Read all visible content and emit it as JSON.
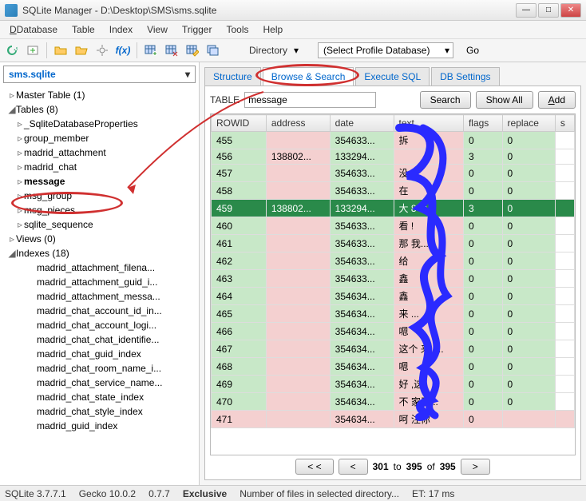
{
  "window": {
    "title": "SQLite Manager - D:\\Desktop\\SMS\\sms.sqlite"
  },
  "menu": [
    "Database",
    "Table",
    "Index",
    "View",
    "Trigger",
    "Tools",
    "Help"
  ],
  "toolbar": {
    "directory_label": "Directory",
    "profile_select": "(Select Profile Database)",
    "go": "Go"
  },
  "sidebar": {
    "db": "sms.sqlite",
    "nodes": [
      {
        "lvl": 0,
        "tw": "▹",
        "label": "Master Table (1)"
      },
      {
        "lvl": 0,
        "tw": "◢",
        "label": "Tables (8)"
      },
      {
        "lvl": 1,
        "tw": "▹",
        "label": "_SqliteDatabaseProperties"
      },
      {
        "lvl": 1,
        "tw": "▹",
        "label": "group_member"
      },
      {
        "lvl": 1,
        "tw": "▹",
        "label": "madrid_attachment"
      },
      {
        "lvl": 1,
        "tw": "▹",
        "label": "madrid_chat"
      },
      {
        "lvl": 1,
        "tw": "▹",
        "label": "message",
        "hl": true
      },
      {
        "lvl": 1,
        "tw": "▹",
        "label": "msg_group"
      },
      {
        "lvl": 1,
        "tw": "▹",
        "label": "msg_pieces"
      },
      {
        "lvl": 1,
        "tw": "▹",
        "label": "sqlite_sequence"
      },
      {
        "lvl": 0,
        "tw": "▹",
        "label": "Views (0)"
      },
      {
        "lvl": 0,
        "tw": "◢",
        "label": "Indexes (18)"
      },
      {
        "lvl": 2,
        "tw": "",
        "label": "madrid_attachment_filena..."
      },
      {
        "lvl": 2,
        "tw": "",
        "label": "madrid_attachment_guid_i..."
      },
      {
        "lvl": 2,
        "tw": "",
        "label": "madrid_attachment_messa..."
      },
      {
        "lvl": 2,
        "tw": "",
        "label": "madrid_chat_account_id_in..."
      },
      {
        "lvl": 2,
        "tw": "",
        "label": "madrid_chat_account_logi..."
      },
      {
        "lvl": 2,
        "tw": "",
        "label": "madrid_chat_chat_identifie..."
      },
      {
        "lvl": 2,
        "tw": "",
        "label": "madrid_chat_guid_index"
      },
      {
        "lvl": 2,
        "tw": "",
        "label": "madrid_chat_room_name_i..."
      },
      {
        "lvl": 2,
        "tw": "",
        "label": "madrid_chat_service_name..."
      },
      {
        "lvl": 2,
        "tw": "",
        "label": "madrid_chat_state_index"
      },
      {
        "lvl": 2,
        "tw": "",
        "label": "madrid_chat_style_index"
      },
      {
        "lvl": 2,
        "tw": "",
        "label": "madrid_guid_index"
      }
    ]
  },
  "tabs": [
    "Structure",
    "Browse & Search",
    "Execute SQL",
    "DB Settings"
  ],
  "active_tab": 1,
  "search": {
    "table_label": "TABLE",
    "table_value": "message",
    "search_btn": "Search",
    "showall_btn": "Show All",
    "add_btn": "Add"
  },
  "columns": [
    "ROWID",
    "address",
    "date",
    "text",
    "flags",
    "replace",
    "s"
  ],
  "rows": [
    {
      "cls": "g",
      "c": [
        "455",
        "",
        "354633...",
        "拆",
        "0",
        "0",
        ""
      ]
    },
    {
      "cls": "g",
      "c": [
        "456",
        "138802...",
        "133294...",
        "",
        "3",
        "0",
        ""
      ]
    },
    {
      "cls": "g",
      "c": [
        "457",
        "",
        "354633...",
        "没",
        "0",
        "0",
        ""
      ]
    },
    {
      "cls": "g",
      "c": [
        "458",
        "",
        "354633...",
        "在",
        "0",
        "0",
        ""
      ]
    },
    {
      "cls": "sel",
      "c": [
        "459",
        "138802...",
        "133294...",
        "大       840...",
        "3",
        "0",
        ""
      ]
    },
    {
      "cls": "g",
      "c": [
        "460",
        "",
        "354633...",
        "看    !",
        "0",
        "0",
        ""
      ]
    },
    {
      "cls": "g",
      "c": [
        "461",
        "",
        "354633...",
        "那    我...",
        "0",
        "0",
        ""
      ]
    },
    {
      "cls": "g",
      "c": [
        "462",
        "",
        "354633...",
        "给",
        "0",
        "0",
        ""
      ]
    },
    {
      "cls": "g",
      "c": [
        "463",
        "",
        "354633...",
        "鑫",
        "0",
        "0",
        ""
      ]
    },
    {
      "cls": "g",
      "c": [
        "464",
        "",
        "354634...",
        "鑫",
        "0",
        "0",
        ""
      ]
    },
    {
      "cls": "g",
      "c": [
        "465",
        "",
        "354634...",
        "来    ...",
        "0",
        "0",
        ""
      ]
    },
    {
      "cls": "g",
      "c": [
        "466",
        "",
        "354634...",
        "嗯",
        "0",
        "0",
        ""
      ]
    },
    {
      "cls": "g",
      "c": [
        "467",
        "",
        "354634...",
        "这个    来,   ...",
        "0",
        "0",
        ""
      ]
    },
    {
      "cls": "g",
      "c": [
        "468",
        "",
        "354634...",
        "嗯",
        "0",
        "0",
        ""
      ]
    },
    {
      "cls": "g",
      "c": [
        "469",
        "",
        "354634...",
        "好    ,这",
        "0",
        "0",
        ""
      ]
    },
    {
      "cls": "g",
      "c": [
        "470",
        "",
        "354634...",
        "不    家了...",
        "0",
        "0",
        ""
      ]
    },
    {
      "cls": "p",
      "c": [
        "471",
        "",
        "354634...",
        "呵    注你",
        "0",
        "",
        ""
      ]
    }
  ],
  "pager": {
    "first": "< <",
    "prev": "<",
    "text1": "301",
    "text2": "to",
    "text3": "395",
    "text4": "of",
    "text5": "395",
    "next": ">"
  },
  "status": {
    "ver": "SQLite 3.7.7.1",
    "gecko": "Gecko 10.0.2",
    "num": "0.7.7",
    "excl": "Exclusive",
    "msg": "Number of files in selected directory...",
    "et": "ET: 17 ms"
  }
}
